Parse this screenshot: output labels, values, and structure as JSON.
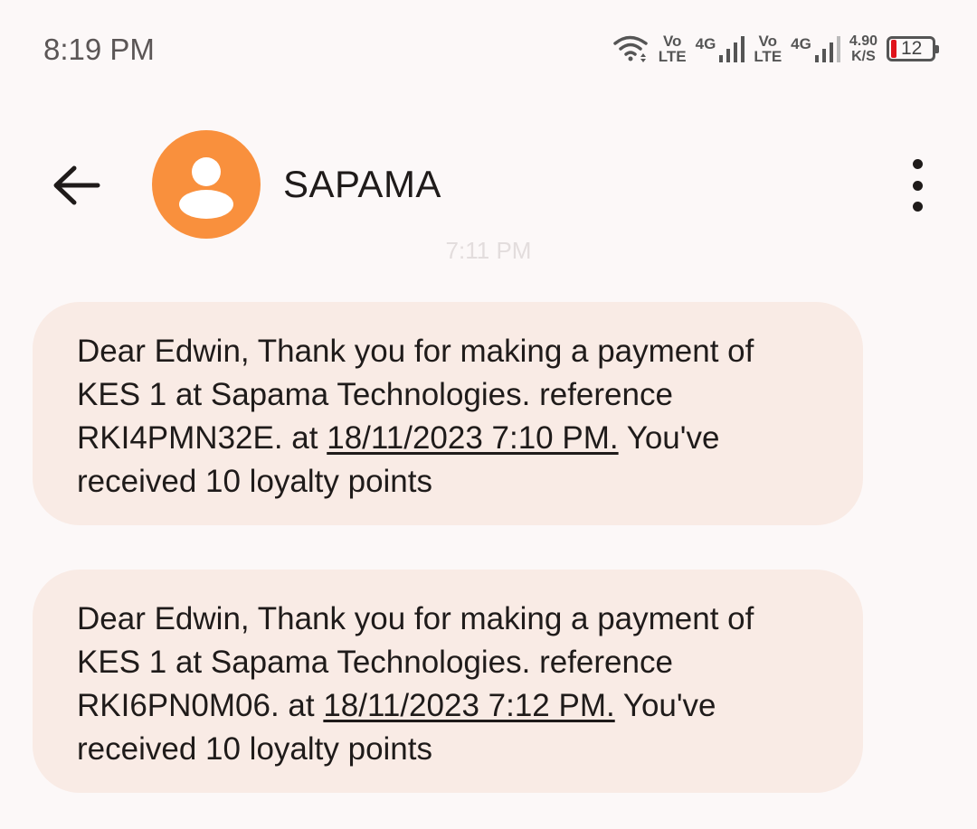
{
  "status_bar": {
    "time": "8:19 PM",
    "sim1": {
      "vo": "Vo",
      "lte": "LTE",
      "network": "4G"
    },
    "sim2": {
      "vo": "Vo",
      "lte": "LTE",
      "network": "4G"
    },
    "speed_value": "4.90",
    "speed_unit": "K/S",
    "battery_level": "12",
    "icons": [
      "wifi-icon",
      "signal-icon",
      "signal-icon",
      "battery-icon"
    ]
  },
  "header": {
    "contact_name": "SAPAMA",
    "avatar_color": "#f9903d",
    "icons": [
      "back-arrow-icon",
      "person-icon",
      "more-vert-icon"
    ]
  },
  "conversation": {
    "timestamp": "7:11 PM",
    "messages": [
      {
        "text_before": "Dear Edwin, Thank you for making a payment of KES 1 at Sapama Technologies. reference RKI4PMN32E. at ",
        "link": "18/11/2023 7:10 PM.",
        "text_after": " You've received 10 loyalty points"
      },
      {
        "text_before": "Dear Edwin, Thank you for making a payment of KES 1 at Sapama Technologies. reference RKI6PN0M06. at ",
        "link": "18/11/2023 7:12 PM.",
        "text_after": " You've received 10 loyalty points"
      }
    ]
  },
  "colors": {
    "background": "#fcf8f8",
    "bubble": "#f9ebe5",
    "battery_low": "#e0131b"
  }
}
